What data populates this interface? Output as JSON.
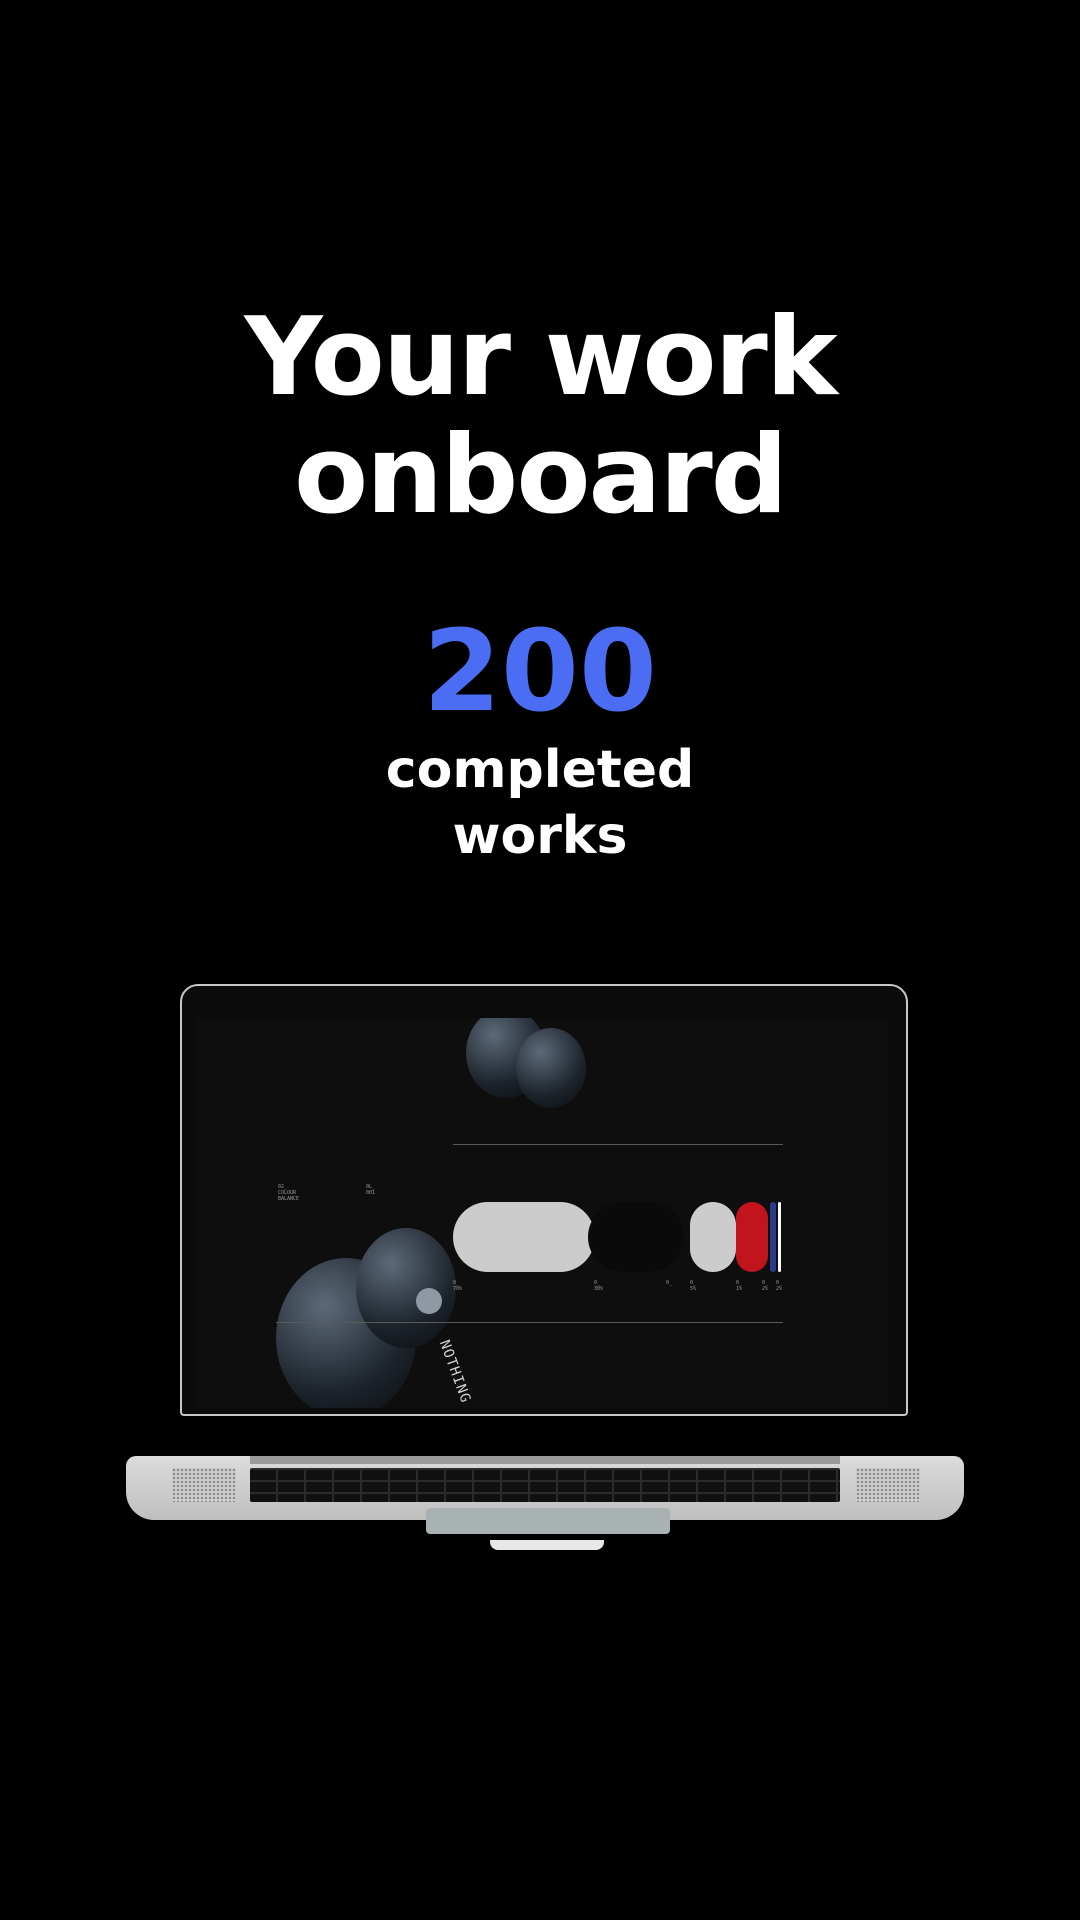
{
  "headline": {
    "line1": "Your work",
    "line2": "onboard"
  },
  "stat": {
    "number": "200",
    "line1": "completed",
    "line2": "works"
  },
  "colors": {
    "accent": "#4a6df4",
    "background": "#000000",
    "text": "#ffffff"
  },
  "screen": {
    "left_label": {
      "col1": "02_\nCOLOUR\nBALANCE",
      "col2": "0L_\n001"
    },
    "pill_labels": [
      "0_\n70%",
      "0_\n30%",
      "0_",
      "0_\n5%",
      "0_\n1%",
      "0_\n2%",
      "0_\n2%"
    ],
    "product_text": "NOTHING ear",
    "swatches": [
      "#cccccc",
      "#0e0e0f",
      "#cccccc",
      "#c1141d",
      "#2c3c8a",
      "#ffffff"
    ]
  }
}
